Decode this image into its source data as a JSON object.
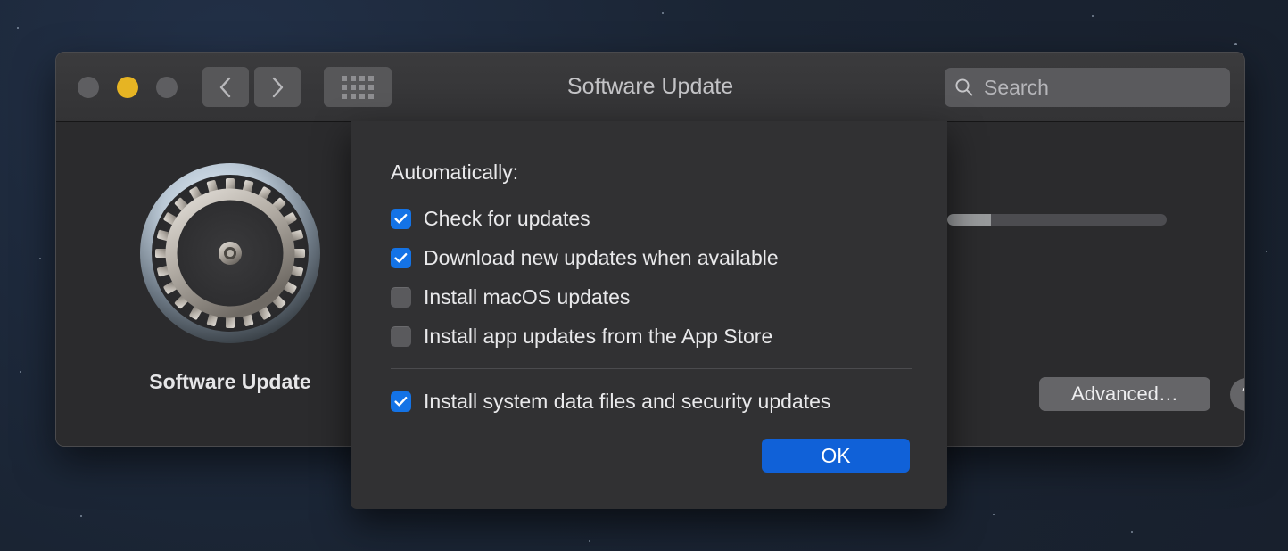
{
  "window": {
    "title": "Software Update",
    "traffic_lights": [
      {
        "name": "close",
        "color": "#5e5e61"
      },
      {
        "name": "minimize",
        "color": "#e6b423"
      },
      {
        "name": "zoom",
        "color": "#5e5e61"
      }
    ],
    "nav": {
      "back_icon": "chevron-left-icon",
      "forward_icon": "chevron-right-icon",
      "grid_icon": "show-all-grid-icon"
    },
    "search": {
      "icon": "search-icon",
      "placeholder": "Search",
      "value": ""
    }
  },
  "pane": {
    "icon_name": "software-update-gear-icon",
    "icon_label": "Software Update",
    "progress": {
      "percent": 20
    },
    "advanced_label": "Advanced…",
    "help_label": "?"
  },
  "sheet": {
    "heading": "Automatically:",
    "options": [
      {
        "label": "Check for updates",
        "checked": true
      },
      {
        "label": "Download new updates when available",
        "checked": true
      },
      {
        "label": "Install macOS updates",
        "checked": false
      },
      {
        "label": "Install app updates from the App Store",
        "checked": false
      }
    ],
    "security_option": {
      "label": "Install system data files and security updates",
      "checked": true
    },
    "ok_label": "OK"
  },
  "colors": {
    "accent_blue": "#1473e6",
    "ok_blue": "#1061d8",
    "amber": "#e6b423",
    "window_bg": "#2b2b2d",
    "sheet_bg": "#313133",
    "desktop": "#1b2433"
  }
}
